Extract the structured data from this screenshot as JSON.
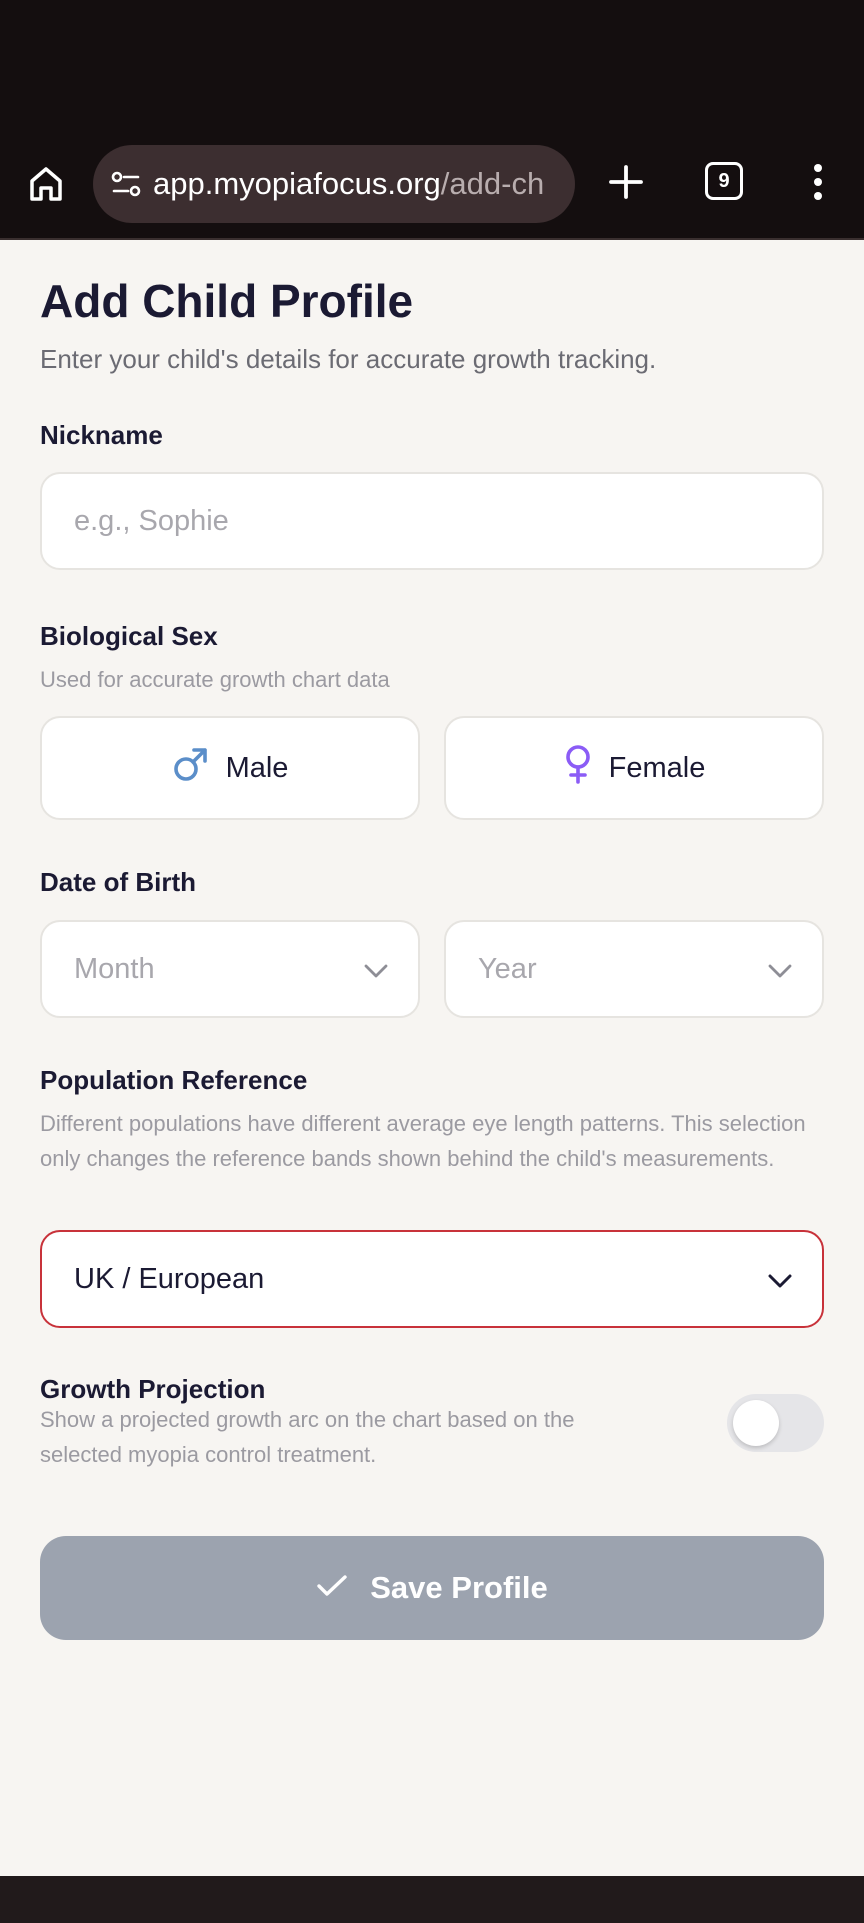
{
  "browser": {
    "url_host": "app.myopiafocus.org",
    "url_path": "/add-ch",
    "tab_count": "9",
    "icons": [
      "home-icon",
      "site-settings-icon",
      "new-tab-plus-icon",
      "tab-switcher-icon",
      "more-menu-icon"
    ]
  },
  "page": {
    "title": "Add Child Profile",
    "subtitle": "Enter your child's details for accurate growth tracking."
  },
  "nickname": {
    "label": "Nickname",
    "placeholder": "e.g., Sophie",
    "value": ""
  },
  "sex": {
    "label": "Biological Sex",
    "hint": "Used for accurate growth chart data",
    "options": [
      {
        "label": "Male",
        "icon": "male-symbol-icon",
        "color": "#5b8ec9"
      },
      {
        "label": "Female",
        "icon": "female-symbol-icon",
        "color": "#8b5cf6"
      }
    ]
  },
  "dob": {
    "label": "Date of Birth",
    "month_placeholder": "Month",
    "year_placeholder": "Year"
  },
  "population": {
    "label": "Population Reference",
    "hint": "Different populations have different average eye length patterns. This selection only changes the reference bands shown behind the child's measurements.",
    "selected": "UK / European",
    "accent": "#c8323a"
  },
  "projection": {
    "label": "Growth Projection",
    "hint": "Show a projected growth arc on the chart based on the selected myopia control treatment.",
    "enabled": false
  },
  "save": {
    "label": "Save Profile",
    "icon": "checkmark-icon",
    "color": "#9ca3af"
  }
}
